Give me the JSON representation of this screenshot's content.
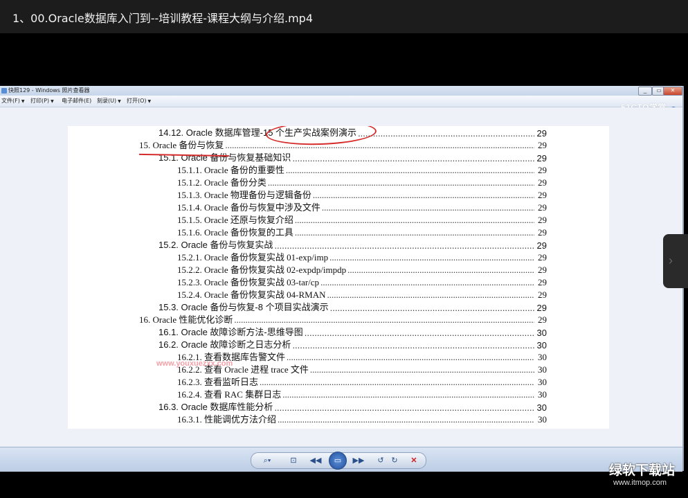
{
  "video_title": "1、00.Oracle数据库入门到--培训教程-课程大纲与介绍.mp4",
  "viewer": {
    "window_title": "快照129 - Windows 照片查看器",
    "menu": [
      {
        "label": "文件(F)"
      },
      {
        "label": "打印(P)"
      },
      {
        "label": "电子邮件(E)"
      },
      {
        "label": "刻录(U)"
      },
      {
        "label": "打开(O)"
      }
    ],
    "brand_watermark": "51CTO学堂",
    "help_label": "?",
    "window_buttons": {
      "minimize": "_",
      "maximize": "▭",
      "close": "✕"
    }
  },
  "toc": [
    {
      "label": "14.12. Oracle 数据库管理-15 个生产实战案例演示",
      "page": "29",
      "level": "2"
    },
    {
      "label": "15. Oracle 备份与恢复",
      "page": "29",
      "level": "1"
    },
    {
      "label": "15.1. Oracle 备份与恢复基础知识",
      "page": "29",
      "level": "2"
    },
    {
      "label": "15.1.1. Oracle 备份的重要性",
      "page": "29",
      "level": "3"
    },
    {
      "label": "15.1.2. Oracle 备份分类",
      "page": "29",
      "level": "3"
    },
    {
      "label": "15.1.3. Oracle 物理备份与逻辑备份",
      "page": "29",
      "level": "3"
    },
    {
      "label": "15.1.4. Oracle 备份与恢复中涉及文件",
      "page": "29",
      "level": "3"
    },
    {
      "label": "15.1.5. Oracle 还原与恢复介绍",
      "page": "29",
      "level": "3"
    },
    {
      "label": "15.1.6. Oracle 备份恢复的工具",
      "page": "29",
      "level": "3"
    },
    {
      "label": "15.2. Oracle 备份与恢复实战",
      "page": "29",
      "level": "2"
    },
    {
      "label": "15.2.1. Oracle 备份恢复实战 01-exp/imp",
      "page": "29",
      "level": "3"
    },
    {
      "label": "15.2.2. Oracle 备份恢复实战 02-expdp/impdp",
      "page": "29",
      "level": "3"
    },
    {
      "label": "15.2.3. Oracle 备份恢复实战 03-tar/cp",
      "page": "29",
      "level": "3"
    },
    {
      "label": "15.2.4. Oracle 备份恢复实战 04-RMAN",
      "page": "29",
      "level": "3"
    },
    {
      "label": "15.3. Oracle 备份与恢复-8 个项目实战演示",
      "page": "29",
      "level": "2"
    },
    {
      "label": "16. Oracle 性能优化诊断",
      "page": "29",
      "level": "1"
    },
    {
      "label": "16.1. Oracle 故障诊断方法-思维导图",
      "page": "30",
      "level": "2"
    },
    {
      "label": "16.2. Oracle 故障诊断之日志分析",
      "page": "30",
      "level": "2"
    },
    {
      "label": "16.2.1.  查看数据库告警文件",
      "page": "30",
      "level": "3"
    },
    {
      "label": "16.2.2.  查看 Oracle 进程 trace 文件",
      "page": "30",
      "level": "3"
    },
    {
      "label": "16.2.3.  查看监听日志",
      "page": "30",
      "level": "3"
    },
    {
      "label": "16.2.4.  查看 RAC 集群日志",
      "page": "30",
      "level": "3"
    },
    {
      "label": "16.3. Oracle 数据库性能分析",
      "page": "30",
      "level": "2"
    },
    {
      "label": "16.3.1.  性能调优方法介绍",
      "page": "30",
      "level": "3"
    }
  ],
  "faint_watermark": "www.youxuezxx.com",
  "controls": {
    "zoom": "⌕▾",
    "actual_size": "⊡",
    "previous": "◀◀",
    "slideshow": "▭",
    "next": "▶▶",
    "rotate_ccw": "↺",
    "rotate_cw": "↻",
    "delete": "✕"
  },
  "scroll_arrow": "›",
  "site_watermark": {
    "name": "绿软下载站",
    "url": "www.itmop.com"
  }
}
